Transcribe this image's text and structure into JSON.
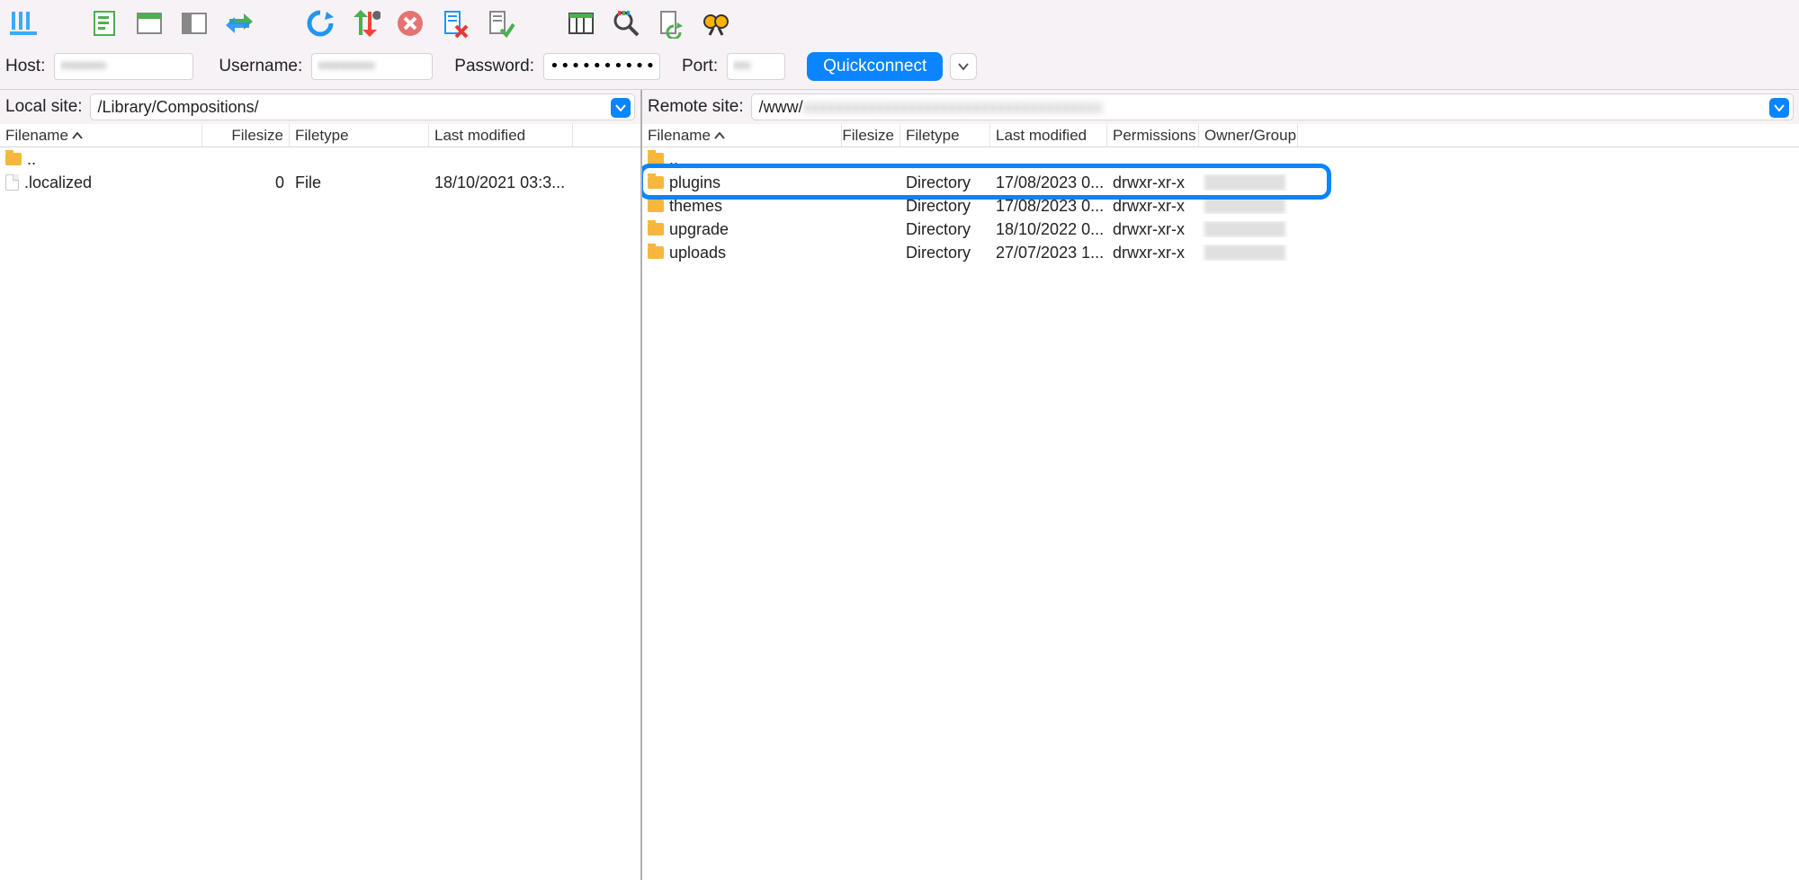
{
  "toolbar": {
    "icons": [
      "site-manager",
      "text-file",
      "toggle-tree",
      "toggle-remote",
      "sync-browse",
      "",
      "refresh",
      "transfer-queue",
      "cancel",
      "filter-off",
      "compare",
      "",
      "view-columns",
      "search-remote",
      "reconnect",
      "find"
    ]
  },
  "qc": {
    "host_label": "Host:",
    "host_value": "••••••••",
    "user_label": "Username:",
    "user_value": "••••••••••",
    "pass_label": "Password:",
    "pass_value": "•••••••••••••",
    "port_label": "Port:",
    "port_value": "•••",
    "btn": "Quickconnect"
  },
  "local": {
    "label": "Local site:",
    "path": "/Library/Compositions/",
    "headers": [
      "Filename",
      "Filesize",
      "Filetype",
      "Last modified"
    ],
    "rows": [
      {
        "icon": "folder",
        "name": "..",
        "size": "",
        "type": "",
        "mod": ""
      },
      {
        "icon": "file",
        "name": ".localized",
        "size": "0",
        "type": "File",
        "mod": "18/10/2021 03:3..."
      }
    ]
  },
  "remote": {
    "label": "Remote site:",
    "path_prefix": "/www/",
    "path_rest_blurred": true,
    "headers": [
      "Filename",
      "Filesize",
      "Filetype",
      "Last modified",
      "Permissions",
      "Owner/Group"
    ],
    "rows": [
      {
        "icon": "folder",
        "name": "..",
        "size": "",
        "type": "",
        "mod": "",
        "perm": "",
        "own": ""
      },
      {
        "icon": "folder",
        "name": "plugins",
        "size": "",
        "type": "Directory",
        "mod": "17/08/2023 0...",
        "perm": "drwxr-xr-x",
        "own": "blur",
        "highlight": true
      },
      {
        "icon": "folder",
        "name": "themes",
        "size": "",
        "type": "Directory",
        "mod": "17/08/2023 0...",
        "perm": "drwxr-xr-x",
        "own": "blur"
      },
      {
        "icon": "folder",
        "name": "upgrade",
        "size": "",
        "type": "Directory",
        "mod": "18/10/2022 0...",
        "perm": "drwxr-xr-x",
        "own": "blur"
      },
      {
        "icon": "folder",
        "name": "uploads",
        "size": "",
        "type": "Directory",
        "mod": "27/07/2023 1...",
        "perm": "drwxr-xr-x",
        "own": "blur"
      }
    ]
  }
}
